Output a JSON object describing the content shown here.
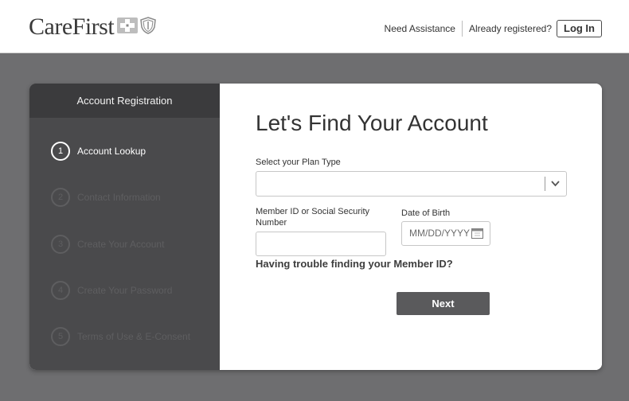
{
  "header": {
    "logo_text": "CareFirst",
    "need_assistance": "Need Assistance",
    "already_registered": "Already registered?",
    "login_label": "Log In"
  },
  "sidebar": {
    "title": "Account Registration",
    "steps": [
      {
        "number": "1",
        "label": "Account Lookup",
        "active": true
      },
      {
        "number": "2",
        "label": "Contact Information",
        "active": false
      },
      {
        "number": "3",
        "label": "Create Your Account",
        "active": false
      },
      {
        "number": "4",
        "label": "Create Your Password",
        "active": false
      },
      {
        "number": "5",
        "label": "Terms of Use & E-Consent",
        "active": false
      }
    ]
  },
  "form": {
    "title": "Let's Find Your Account",
    "plan_type_label": "Select your Plan Type",
    "plan_type_value": "",
    "member_id_label": "Member ID or Social Security Number",
    "member_id_value": "",
    "dob_label": "Date of Birth",
    "dob_placeholder": "MM/DD/YYYY",
    "trouble_link": "Having trouble finding your Member ID?",
    "next_label": "Next"
  },
  "icons": {
    "cross": "blue-cross-icon",
    "shield": "blue-shield-icon",
    "chevron": "chevron-down-icon",
    "calendar": "calendar-icon"
  }
}
